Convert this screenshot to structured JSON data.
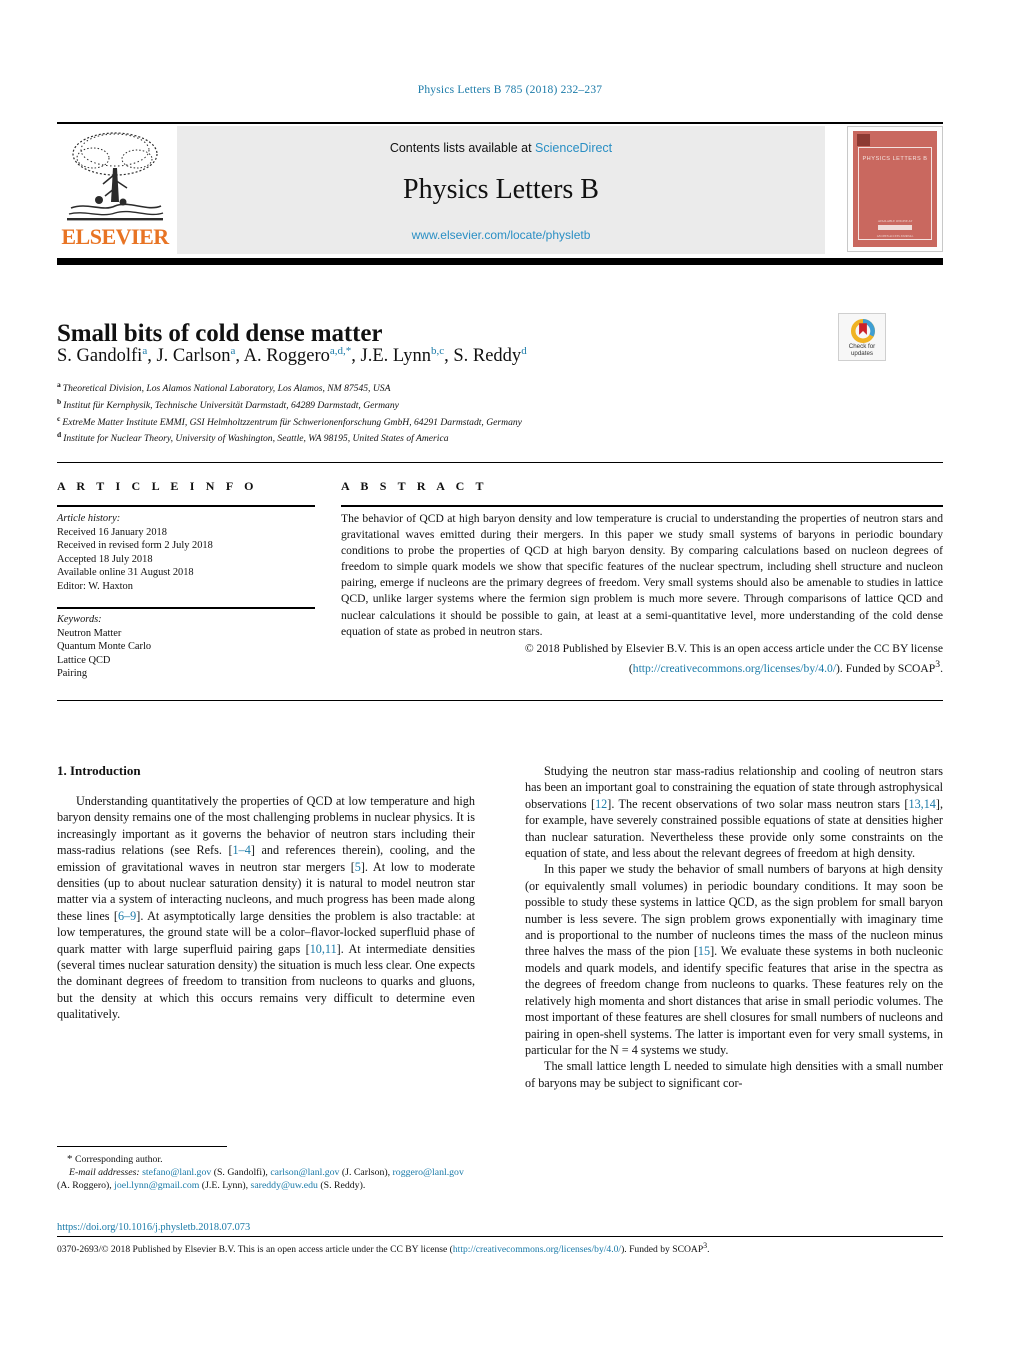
{
  "running_head": "Physics Letters B 785 (2018) 232–237",
  "banner": {
    "publisher_name": "ELSEVIER",
    "contents_prefix": "Contents lists available at ",
    "sciencedirect": "ScienceDirect",
    "journal_title": "Physics Letters B",
    "journal_url": "www.elsevier.com/locate/physletb",
    "cover": {
      "title": "PHYSICS LETTERS B",
      "footer_small": "AVAILABLE ONLINE AT",
      "footer_bottom": "AN OPEN ACCESS JOURNAL"
    }
  },
  "article": {
    "title": "Small bits of cold dense matter",
    "authors": [
      {
        "name": "S. Gandolfi",
        "marks": "a",
        "sep": ", "
      },
      {
        "name": "J. Carlson",
        "marks": "a",
        "sep": ", "
      },
      {
        "name": "A. Roggero",
        "marks": "a,d,",
        "star": "*",
        "sep": ", "
      },
      {
        "name": "J.E. Lynn",
        "marks": "b,c",
        "sep": ", "
      },
      {
        "name": "S. Reddy",
        "marks": "d",
        "sep": ""
      }
    ],
    "affiliations": [
      {
        "mark": "a",
        "text": "Theoretical Division, Los Alamos National Laboratory, Los Alamos, NM 87545, USA"
      },
      {
        "mark": "b",
        "text": "Institut für Kernphysik, Technische Universität Darmstadt, 64289 Darmstadt, Germany"
      },
      {
        "mark": "c",
        "text": "ExtreMe Matter Institute EMMI, GSI Helmholtzzentrum für Schwerionenforschung GmbH, 64291 Darmstadt, Germany"
      },
      {
        "mark": "d",
        "text": "Institute for Nuclear Theory, University of Washington, Seattle, WA 98195, United States of America"
      }
    ]
  },
  "crossmark": {
    "line1": "Check for",
    "line2": "updates"
  },
  "article_info": {
    "heading": "A R T I C L E   I N F O",
    "history_label": "Article history:",
    "history": [
      "Received 16 January 2018",
      "Received in revised form 2 July 2018",
      "Accepted 18 July 2018",
      "Available online 31 August 2018",
      "Editor: W. Haxton"
    ],
    "keywords_label": "Keywords:",
    "keywords": [
      "Neutron Matter",
      "Quantum Monte Carlo",
      "Lattice QCD",
      "Pairing"
    ]
  },
  "abstract": {
    "heading": "A B S T R A C T",
    "text": "The behavior of QCD at high baryon density and low temperature is crucial to understanding the properties of neutron stars and gravitational waves emitted during their mergers. In this paper we study small systems of baryons in periodic boundary conditions to probe the properties of QCD at high baryon density. By comparing calculations based on nucleon degrees of freedom to simple quark models we show that specific features of the nuclear spectrum, including shell structure and nucleon pairing, emerge if nucleons are the primary degrees of freedom. Very small systems should also be amenable to studies in lattice QCD, unlike larger systems where the fermion sign problem is much more severe. Through comparisons of lattice QCD and nuclear calculations it should be possible to gain, at least at a semi-quantitative level, more understanding of the cold dense equation of state as probed in neutron stars.",
    "copyright_pre": "© 2018 Published by Elsevier B.V. This is an open access article under the CC BY license (",
    "copyright_link": "http://creativecommons.org/licenses/by/4.0/",
    "copyright_post": "). Funded by SCOAP",
    "copyright_sup": "3",
    "copyright_end": "."
  },
  "body": {
    "section1_heading": "1. Introduction",
    "left_paragraphs": [
      "Understanding quantitatively the properties of QCD at low temperature and high baryon density remains one of the most challenging problems in nuclear physics. It is increasingly important as it governs the behavior of neutron stars including their mass-radius relations (see Refs. [1–4] and references therein), cooling, and the emission of gravitational waves in neutron star mergers [5]. At low to moderate densities (up to about nuclear saturation density) it is natural to model neutron star matter via a system of interacting nucleons, and much progress has been made along these lines [6–9]. At asymptotically large densities the problem is also tractable: at low temperatures, the ground state will be a color–flavor-locked superfluid phase of quark matter with large superfluid pairing gaps [10,11]. At intermediate densities (several times nuclear saturation density) the situation is much less clear. One expects the dominant degrees of freedom to transition from nucleons to quarks and gluons, but the density at which this occurs remains very difficult to determine even qualitatively."
    ],
    "right_paragraphs": [
      "Studying the neutron star mass-radius relationship and cooling of neutron stars has been an important goal to constraining the equation of state through astrophysical observations [12]. The recent observations of two solar mass neutron stars [13,14], for example, have severely constrained possible equations of state at densities higher than nuclear saturation. Nevertheless these provide only some constraints on the equation of state, and less about the relevant degrees of freedom at high density.",
      "In this paper we study the behavior of small numbers of baryons at high density (or equivalently small volumes) in periodic boundary conditions. It may soon be possible to study these systems in lattice QCD, as the sign problem for small baryon number is less severe. The sign problem grows exponentially with imaginary time and is proportional to the number of nucleons times the mass of the nucleon minus three halves the mass of the pion [15]. We evaluate these systems in both nucleonic models and quark models, and identify specific features that arise in the spectra as the degrees of freedom change from nucleons to quarks. These features rely on the relatively high momenta and short distances that arise in small periodic volumes. The most important of these features are shell closures for small numbers of nucleons and pairing in open-shell systems. The latter is important even for very small systems, in particular for the N = 4 systems we study.",
      "The small lattice length L needed to simulate high densities with a small number of baryons may be subject to significant cor-"
    ]
  },
  "footnotes": {
    "corresponding_star": "*",
    "corresponding_label": "Corresponding author.",
    "email_label": "E-mail addresses:",
    "emails": [
      {
        "address": "stefano@lanl.gov",
        "owner": " (S. Gandolfi), "
      },
      {
        "address": "carlson@lanl.gov",
        "owner": " (J. Carlson), "
      },
      {
        "address": "roggero@lanl.gov",
        "owner": " (A. Roggero), "
      },
      {
        "address": "joel.lynn@gmail.com",
        "owner": " (J.E. Lynn), "
      },
      {
        "address": "sareddy@uw.edu",
        "owner": " (S. Reddy)."
      }
    ]
  },
  "footer": {
    "doi": "https://doi.org/10.1016/j.physletb.2018.07.073",
    "issn_copyright_pre": "0370-2693/© 2018 Published by Elsevier B.V. This is an open access article under the CC BY license (",
    "issn_copyright_link": "http://creativecommons.org/licenses/by/4.0/",
    "issn_copyright_post": "). Funded by SCOAP",
    "issn_copyright_sup": "3",
    "issn_copyright_end": "."
  },
  "colors": {
    "link": "#1a7aa8",
    "elsevier_orange": "#e87424",
    "banner_gray": "#ebebeb",
    "cover_red": "#c9685f"
  }
}
